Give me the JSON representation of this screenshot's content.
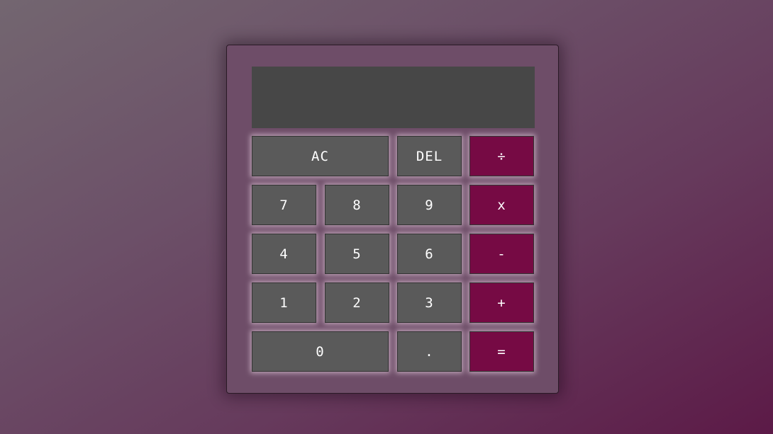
{
  "display": {
    "previous_operand": "",
    "current_operand": ""
  },
  "keys": {
    "all_clear": "AC",
    "delete": "DEL",
    "divide": "÷",
    "seven": "7",
    "eight": "8",
    "nine": "9",
    "multiply": "x",
    "four": "4",
    "five": "5",
    "six": "6",
    "subtract": "-",
    "one": "1",
    "two": "2",
    "three": "3",
    "add": "+",
    "zero": "0",
    "decimal": ".",
    "equals": "="
  },
  "colors": {
    "background_start": "#736670",
    "background_end": "#5c1a47",
    "calculator_body": "#6e4d68",
    "display": "#474747",
    "key": "#5a5a5a",
    "operator_key": "#760a44",
    "key_text": "#ffffff"
  }
}
